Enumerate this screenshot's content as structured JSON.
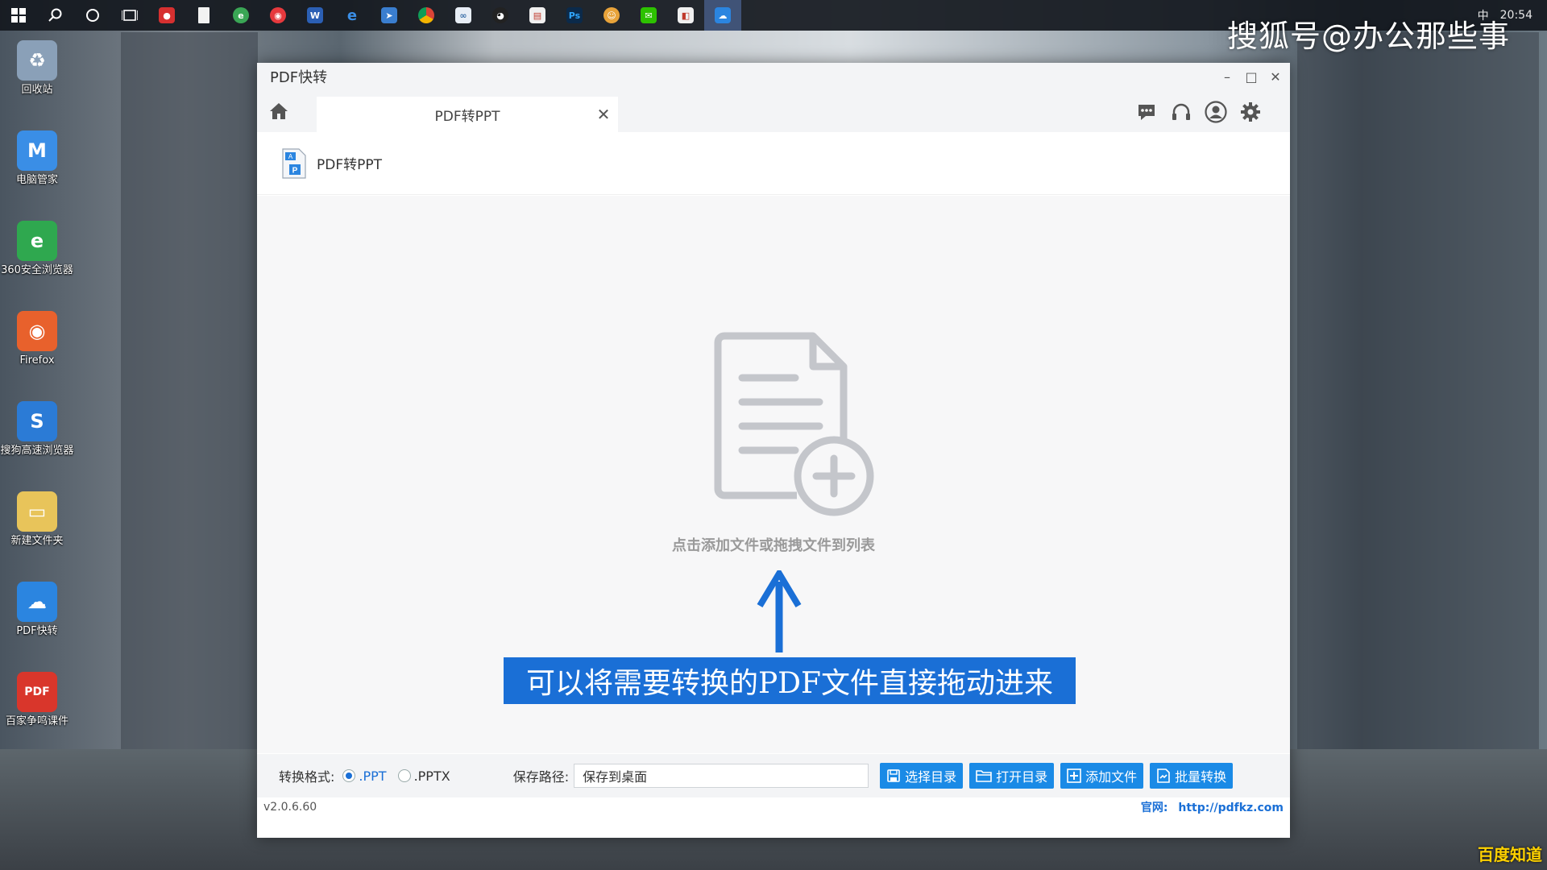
{
  "taskbar": {
    "tray_time": "20:54",
    "ime": "中",
    "apps": [
      {
        "icon": "windows-start-icon"
      },
      {
        "icon": "search-icon"
      },
      {
        "icon": "cortana-icon"
      },
      {
        "icon": "task-view-icon"
      },
      {
        "icon": "app-red-icon"
      },
      {
        "icon": "file-icon"
      },
      {
        "icon": "app-green-icon"
      },
      {
        "icon": "weibo-icon"
      },
      {
        "icon": "word-icon"
      },
      {
        "icon": "edge-icon"
      },
      {
        "icon": "app-blue-icon"
      },
      {
        "icon": "chrome-icon"
      },
      {
        "icon": "app-link-icon"
      },
      {
        "icon": "qq-icon"
      },
      {
        "icon": "app-doc-icon"
      },
      {
        "icon": "photoshop-icon"
      },
      {
        "icon": "app-face-icon"
      },
      {
        "icon": "wechat-icon"
      },
      {
        "icon": "app-window-icon"
      },
      {
        "icon": "pdfkz-taskbar-icon"
      }
    ]
  },
  "watermark": "搜狐号@办公那些事",
  "desktop_icons": [
    {
      "label": "回收站",
      "icon": "recycle-bin-icon",
      "color": "#8aa0b8"
    },
    {
      "label": "电脑管家",
      "icon": "pc-manager-icon",
      "color": "#3a8ee6"
    },
    {
      "label": "360安全浏览器",
      "icon": "360-browser-icon",
      "color": "#2fa84f"
    },
    {
      "label": "Firefox",
      "icon": "firefox-icon",
      "color": "#e8612c"
    },
    {
      "label": "搜狗高速浏览器",
      "icon": "sogou-browser-icon",
      "color": "#2b7bd6"
    },
    {
      "label": "新建文件夹",
      "icon": "folder-icon",
      "color": "#e8c45a"
    },
    {
      "label": "PDF快转",
      "icon": "pdfkz-cloud-icon",
      "color": "#2b85e0"
    },
    {
      "label": "百家争鸣课件",
      "icon": "pdf-file-icon",
      "color": "#d9362b"
    }
  ],
  "window": {
    "title": "PDF快转",
    "tab_label": "PDF转PPT",
    "subheader_label": "PDF转PPT",
    "drop_hint": "点击添加文件或拖拽文件到列表",
    "banner": "可以将需要转换的PDF文件直接拖动进来",
    "bottom": {
      "format_label": "转换格式:",
      "format_options": [
        {
          "label": ".PPT",
          "selected": true
        },
        {
          "label": ".PPTX",
          "selected": false
        }
      ],
      "save_path_label": "保存路径:",
      "save_path_value": "保存到桌面",
      "buttons": [
        {
          "label": "选择目录",
          "icon": "save-dir-icon"
        },
        {
          "label": "打开目录",
          "icon": "open-folder-icon"
        },
        {
          "label": "添加文件",
          "icon": "add-file-icon"
        },
        {
          "label": "批量转换",
          "icon": "batch-convert-icon"
        }
      ]
    },
    "version": "v2.0.6.60",
    "site_label": "官网:",
    "site_url": "http://pdfkz.com"
  },
  "colors": {
    "accent": "#1a6fd6",
    "button": "#1a8ae6",
    "dropzone_bg": "#f7f7f8"
  },
  "corner_logo": "百度知道"
}
